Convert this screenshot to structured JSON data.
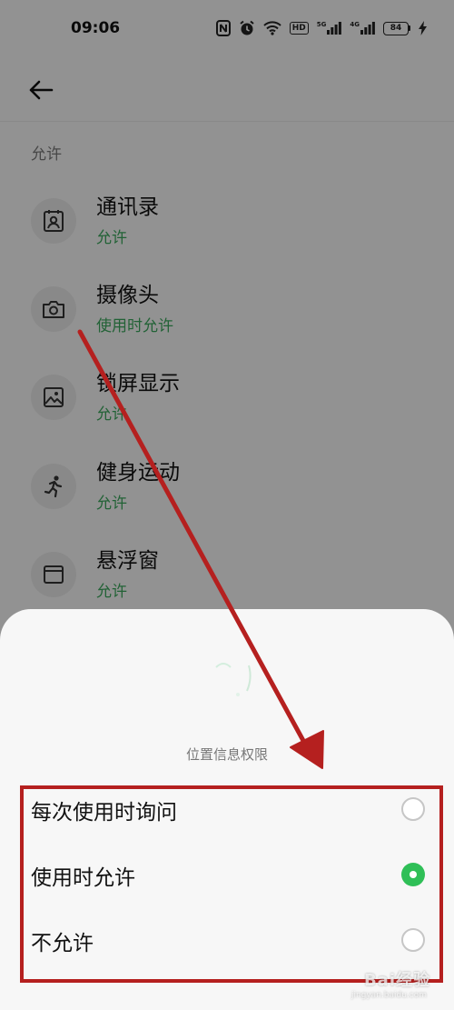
{
  "status_bar": {
    "time": "09:06",
    "hd_label": "HD",
    "net1_label": "5G",
    "net2_label": "4G",
    "battery": "84"
  },
  "header": {
    "back_icon": "arrow-left-icon"
  },
  "section_label": "允许",
  "permissions": [
    {
      "title": "通讯录",
      "status": "允许",
      "icon": "contacts-icon"
    },
    {
      "title": "摄像头",
      "status": "使用时允许",
      "icon": "camera-icon"
    },
    {
      "title": "锁屏显示",
      "status": "允许",
      "icon": "image-icon"
    },
    {
      "title": "健身运动",
      "status": "允许",
      "icon": "running-icon"
    },
    {
      "title": "悬浮窗",
      "status": "允许",
      "icon": "floating-window-icon"
    }
  ],
  "sheet": {
    "title": "位置信息权限",
    "options": [
      {
        "label": "每次使用时询问",
        "selected": false
      },
      {
        "label": "使用时允许",
        "selected": true
      },
      {
        "label": "不允许",
        "selected": false
      }
    ]
  },
  "watermark": {
    "text": "Bai经验",
    "sub": "jingyan.baidu.com"
  },
  "colors": {
    "status_green": "#3aa45a",
    "radio_selected": "#2fbf57",
    "annotation_red": "#b5201f"
  }
}
